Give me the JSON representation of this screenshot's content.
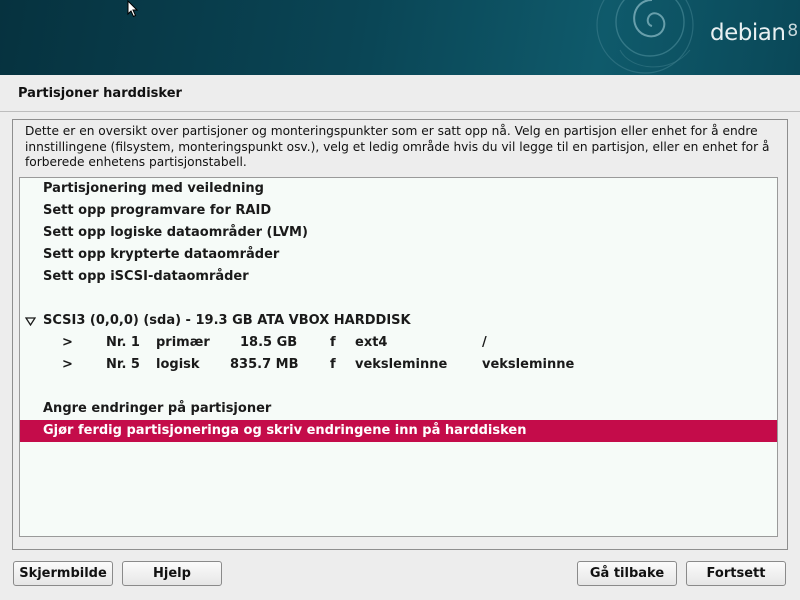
{
  "header": {
    "brand": "debian",
    "brand_version": "8"
  },
  "page_title": "Partisjoner harddisker",
  "description": "Dette er en oversikt over partisjoner og monteringspunkter som er satt opp nå. Velg en partisjon eller enhet for å endre innstillingene (filsystem, monteringspunkt osv.), velg et ledig område hvis du vil legge til en partisjon, eller en enhet for å forberede enhetens partisjonstabell.",
  "menu_items": [
    "Partisjonering med veiledning",
    "Sett opp programvare for RAID",
    "Sett opp logiske dataområder (LVM)",
    "Sett opp krypterte dataområder",
    "Sett opp iSCSI-dataområder"
  ],
  "disk": {
    "label": "SCSI3 (0,0,0) (sda) - 19.3 GB ATA VBOX HARDDISK",
    "partitions": [
      {
        "marker": ">",
        "number": "Nr. 1",
        "type": "primær",
        "size": "18.5 GB",
        "flag": "f",
        "fs": "ext4",
        "mount": "/"
      },
      {
        "marker": ">",
        "number": "Nr. 5",
        "type": "logisk",
        "size": "835.7 MB",
        "flag": "f",
        "fs": "veksleminne",
        "mount": "veksleminne"
      }
    ]
  },
  "undo_label": "Angre endringer på partisjoner",
  "finish_label": "Gjør ferdig partisjoneringa og skriv endringene inn på harddisken",
  "buttons": {
    "screenshot": "Skjermbilde",
    "help": "Hjelp",
    "back": "Gå tilbake",
    "continue": "Fortsett"
  },
  "colors": {
    "selection": "#c40c4a",
    "banner": "#0a4555"
  }
}
